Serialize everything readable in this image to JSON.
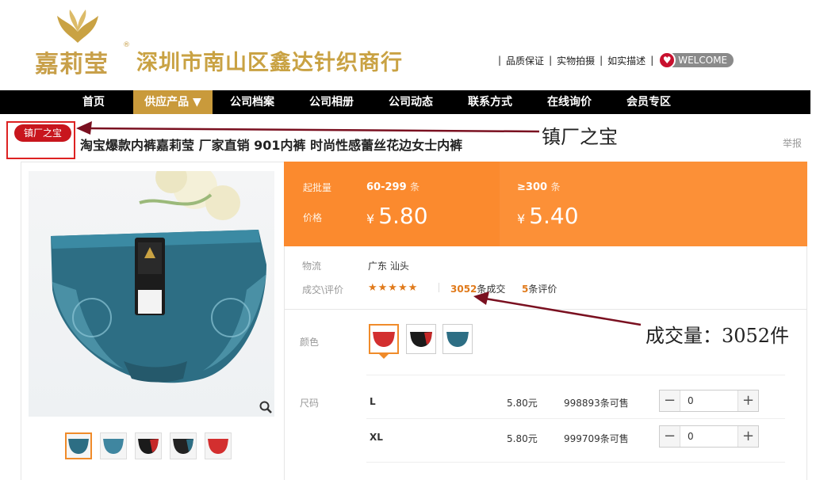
{
  "header": {
    "brand": "嘉莉莹",
    "registered": "®",
    "company": "深圳市南山区鑫达针织商行",
    "links": [
      "品质保证",
      "实物拍摄",
      "如实描述"
    ],
    "welcome": "WELCOME"
  },
  "nav": {
    "items": [
      {
        "label": "首页"
      },
      {
        "label": "供应产品 ▼"
      },
      {
        "label": "公司档案"
      },
      {
        "label": "公司相册"
      },
      {
        "label": "公司动态"
      },
      {
        "label": "联系方式"
      },
      {
        "label": "在线询价"
      },
      {
        "label": "会员专区"
      }
    ],
    "active_index": 1
  },
  "product": {
    "badge": "镇厂之宝",
    "title": "淘宝爆款内裤嘉莉莹 厂家直销 901内裤 时尚性感蕾丝花边女士内裤",
    "report": "举报"
  },
  "annotations": {
    "badge_note": "镇厂之宝",
    "sales_note": "成交量：3052件"
  },
  "pricing": {
    "qty_label": "起批量",
    "price_label": "价格",
    "currency": "¥",
    "tiers": [
      {
        "range": "60-299",
        "unit": "条",
        "price": "5.80"
      },
      {
        "range": "≥300",
        "unit": "条",
        "price": "5.40"
      }
    ]
  },
  "details": {
    "logistics_label": "物流",
    "logistics_value": "广东 汕头",
    "deal_label": "成交\\评价",
    "stars": "★★★★★",
    "deal_count": "3052",
    "deal_suffix": "条成交",
    "review_count": "5",
    "review_suffix": "条评价"
  },
  "color": {
    "label": "颜色",
    "options": [
      "red",
      "black",
      "teal"
    ],
    "selected": 0
  },
  "size": {
    "label": "尺码",
    "rows": [
      {
        "name": "L",
        "price": "5.80元",
        "stock": "998893条可售",
        "qty": "0"
      },
      {
        "name": "XL",
        "price": "5.80元",
        "stock": "999709条可售",
        "qty": "0"
      }
    ]
  },
  "gallery": {
    "thumbs": [
      "teal",
      "teal",
      "black",
      "black",
      "red"
    ],
    "selected": 0
  },
  "colors": {
    "gold": "#c9a243",
    "orange": "#fb8a2e",
    "nav_bg": "#000000",
    "badge_red": "#c8161d"
  }
}
